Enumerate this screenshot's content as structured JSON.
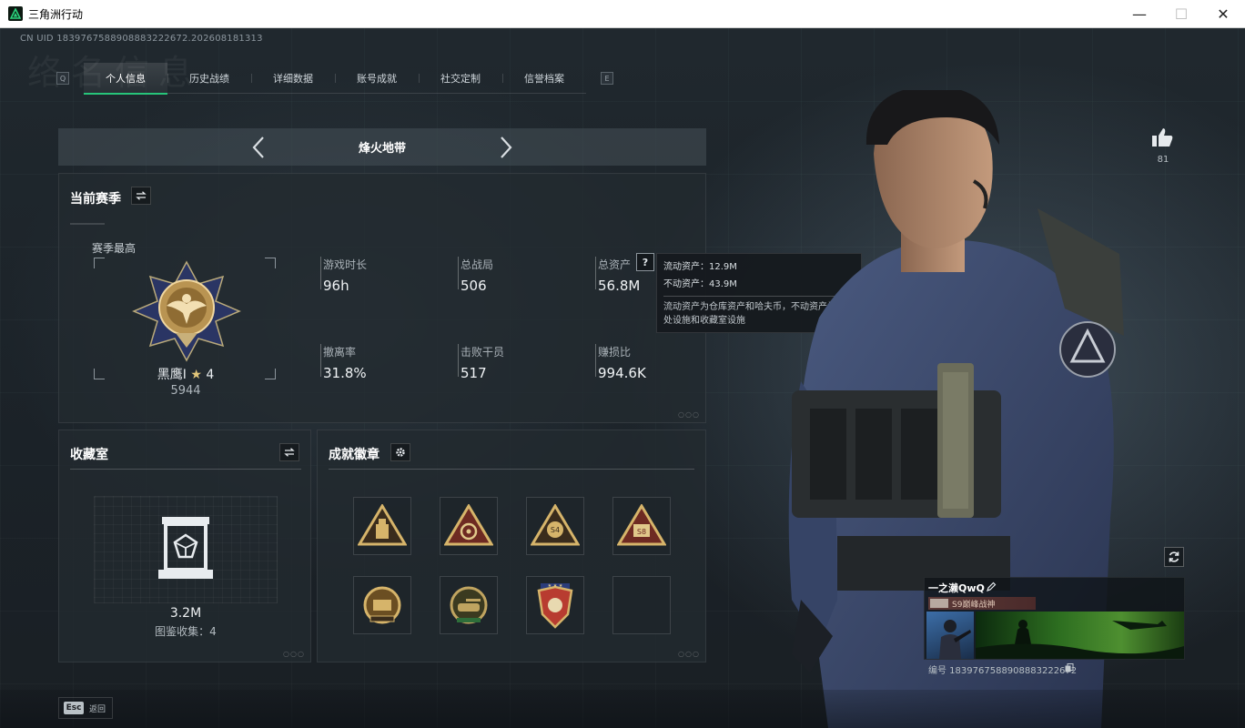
{
  "window": {
    "title": "三角洲行动",
    "minimize_glyph": "—",
    "maximize_glyph": "☐",
    "close_glyph": "✕"
  },
  "header": {
    "uid_text": "CN UID 1839767588908883222672.202608181313",
    "watermark": "络名信息"
  },
  "tabs": {
    "left_key": "Q",
    "right_key": "E",
    "items": [
      {
        "label": "个人信息",
        "active": true
      },
      {
        "label": "历史战绩",
        "active": false
      },
      {
        "label": "详细数据",
        "active": false
      },
      {
        "label": "账号成就",
        "active": false
      },
      {
        "label": "社交定制",
        "active": false
      },
      {
        "label": "信誉档案",
        "active": false
      }
    ]
  },
  "mode": {
    "name": "烽火地带",
    "prev_icon": "chevron-left-icon",
    "next_icon": "chevron-right-icon"
  },
  "season": {
    "title": "当前赛季",
    "best_label": "赛季最高",
    "rank_name": "黑鹰Ⅰ",
    "rank_stars": "4",
    "rank_score": "5944",
    "stats": [
      {
        "label": "游戏时长",
        "value": "96h"
      },
      {
        "label": "总战局",
        "value": "506"
      },
      {
        "label": "总资产",
        "value": "56.8M"
      },
      {
        "label": "撤离率",
        "value": "31.8%"
      },
      {
        "label": "击败干员",
        "value": "517"
      },
      {
        "label": "赚损比",
        "value": "994.6K"
      }
    ],
    "help_glyph": "?"
  },
  "tooltip": {
    "liquid": "流动资产：12.9M",
    "fixed": "不动资产：43.9M",
    "desc": "流动资产为仓库资产和哈夫币，不动资产为特勤处设施和收藏室设施"
  },
  "collection": {
    "title": "收藏室",
    "value": "3.2M",
    "sub": "图鉴收集：4"
  },
  "achievements": {
    "title": "成就徽章",
    "badges": [
      {
        "icon": "triangle-ammo-badge-icon",
        "color": "#c9a45a"
      },
      {
        "icon": "triangle-target-badge-icon",
        "color": "#b0503c"
      },
      {
        "icon": "triangle-s4-badge-icon",
        "color": "#c9a45a",
        "label": "S4"
      },
      {
        "icon": "triangle-s8-badge-icon",
        "color": "#b0503c",
        "label": "S8"
      },
      {
        "icon": "round-crest-badge-icon",
        "color": "#b48a4a"
      },
      {
        "icon": "round-tank-badge-icon",
        "color": "#8c7a4a"
      },
      {
        "icon": "shield-eagle-badge-icon",
        "color": "#c2463a"
      },
      {
        "icon": "empty-slot",
        "color": ""
      }
    ]
  },
  "profile": {
    "likes": "81",
    "player_name": "一之濑QwQ",
    "player_rank": "S9巅峰战神",
    "player_id": "编号 1839767588908883222672"
  },
  "bottom": {
    "esc_key": "Esc",
    "esc_label": "返回"
  },
  "colors": {
    "accent_green": "#27c47a",
    "panel_bg": "#222a30",
    "text_main": "#e3e8ec"
  }
}
